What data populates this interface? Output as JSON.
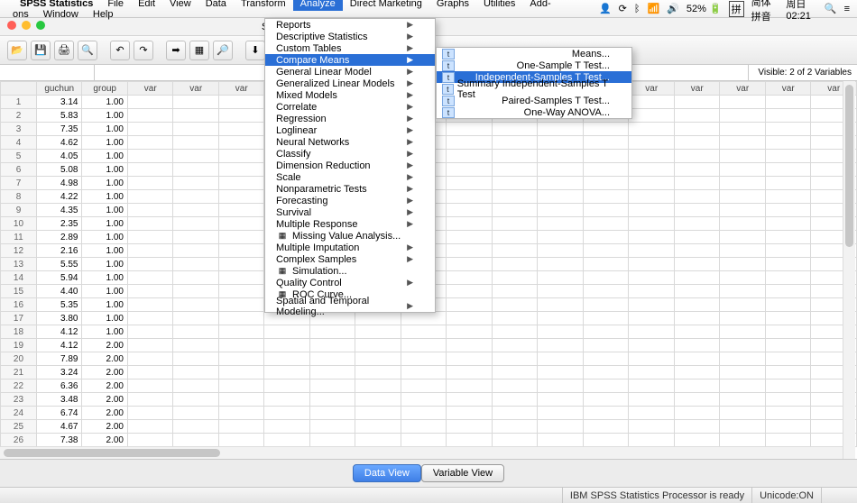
{
  "mac_menu": {
    "items": [
      "SPSS Statistics",
      "File",
      "Edit",
      "View",
      "Data",
      "Transform",
      "Analyze",
      "Direct Marketing",
      "Graphs",
      "Utilities",
      "Add-ons",
      "Window",
      "Help"
    ],
    "highlighted_index": 6,
    "right": {
      "battery": "52%",
      "ime_box": "拼",
      "ime_label": "简体拼音",
      "clock": "周日02:21"
    }
  },
  "window": {
    "title": "SPSS Statistics Data Editor"
  },
  "formula": {
    "visible_text": "Visible: 2 of 2 Variables"
  },
  "columns": {
    "named": [
      "guchun",
      "group"
    ],
    "var_placeholder": "var",
    "extra_count": 16
  },
  "rows": [
    {
      "n": 1,
      "guchun": "3.14",
      "group": "1.00"
    },
    {
      "n": 2,
      "guchun": "5.83",
      "group": "1.00"
    },
    {
      "n": 3,
      "guchun": "7.35",
      "group": "1.00"
    },
    {
      "n": 4,
      "guchun": "4.62",
      "group": "1.00"
    },
    {
      "n": 5,
      "guchun": "4.05",
      "group": "1.00"
    },
    {
      "n": 6,
      "guchun": "5.08",
      "group": "1.00"
    },
    {
      "n": 7,
      "guchun": "4.98",
      "group": "1.00"
    },
    {
      "n": 8,
      "guchun": "4.22",
      "group": "1.00"
    },
    {
      "n": 9,
      "guchun": "4.35",
      "group": "1.00"
    },
    {
      "n": 10,
      "guchun": "2.35",
      "group": "1.00"
    },
    {
      "n": 11,
      "guchun": "2.89",
      "group": "1.00"
    },
    {
      "n": 12,
      "guchun": "2.16",
      "group": "1.00"
    },
    {
      "n": 13,
      "guchun": "5.55",
      "group": "1.00"
    },
    {
      "n": 14,
      "guchun": "5.94",
      "group": "1.00"
    },
    {
      "n": 15,
      "guchun": "4.40",
      "group": "1.00"
    },
    {
      "n": 16,
      "guchun": "5.35",
      "group": "1.00"
    },
    {
      "n": 17,
      "guchun": "3.80",
      "group": "1.00"
    },
    {
      "n": 18,
      "guchun": "4.12",
      "group": "1.00"
    },
    {
      "n": 19,
      "guchun": "4.12",
      "group": "2.00"
    },
    {
      "n": 20,
      "guchun": "7.89",
      "group": "2.00"
    },
    {
      "n": 21,
      "guchun": "3.24",
      "group": "2.00"
    },
    {
      "n": 22,
      "guchun": "6.36",
      "group": "2.00"
    },
    {
      "n": 23,
      "guchun": "3.48",
      "group": "2.00"
    },
    {
      "n": 24,
      "guchun": "6.74",
      "group": "2.00"
    },
    {
      "n": 25,
      "guchun": "4.67",
      "group": "2.00"
    },
    {
      "n": 26,
      "guchun": "7.38",
      "group": "2.00"
    }
  ],
  "analyze_menu": {
    "items": [
      {
        "label": "Reports",
        "sub": true
      },
      {
        "label": "Descriptive Statistics",
        "sub": true
      },
      {
        "label": "Custom Tables",
        "sub": true
      },
      {
        "label": "Compare Means",
        "sub": true,
        "hl": true
      },
      {
        "label": "General Linear Model",
        "sub": true
      },
      {
        "label": "Generalized Linear Models",
        "sub": true
      },
      {
        "label": "Mixed Models",
        "sub": true
      },
      {
        "label": "Correlate",
        "sub": true
      },
      {
        "label": "Regression",
        "sub": true
      },
      {
        "label": "Loglinear",
        "sub": true
      },
      {
        "label": "Neural Networks",
        "sub": true
      },
      {
        "label": "Classify",
        "sub": true
      },
      {
        "label": "Dimension Reduction",
        "sub": true
      },
      {
        "label": "Scale",
        "sub": true
      },
      {
        "label": "Nonparametric Tests",
        "sub": true
      },
      {
        "label": "Forecasting",
        "sub": true
      },
      {
        "label": "Survival",
        "sub": true
      },
      {
        "label": "Multiple Response",
        "sub": true
      },
      {
        "label": "Missing Value Analysis...",
        "sub": false,
        "icon": "mva"
      },
      {
        "label": "Multiple Imputation",
        "sub": true
      },
      {
        "label": "Complex Samples",
        "sub": true
      },
      {
        "label": "Simulation...",
        "sub": false,
        "icon": "sim"
      },
      {
        "label": "Quality Control",
        "sub": true
      },
      {
        "label": "ROC Curve...",
        "sub": false,
        "icon": "roc"
      },
      {
        "label": "Spatial and Temporal Modeling...",
        "sub": true
      }
    ]
  },
  "compare_means_submenu": {
    "items": [
      {
        "label": "Means...",
        "icon": "M"
      },
      {
        "label": "One-Sample T Test...",
        "icon": "t"
      },
      {
        "label": "Independent-Samples T Test...",
        "icon": "it",
        "hl": true
      },
      {
        "label": "Summary Independent-Samples T Test",
        "icon": "sit"
      },
      {
        "label": "Paired-Samples T Test...",
        "icon": "pt"
      },
      {
        "label": "One-Way ANOVA...",
        "icon": "a"
      }
    ]
  },
  "tabs": {
    "data": "Data View",
    "variable": "Variable View",
    "active": "data"
  },
  "status": {
    "processor": "IBM SPSS Statistics Processor is ready",
    "unicode": "Unicode:ON"
  },
  "toolbar_icons": [
    "open",
    "save",
    "print",
    "examine",
    "undo",
    "redo",
    "goto",
    "vars",
    "find",
    "insert-case",
    "insert-var",
    "split",
    "weight",
    "select",
    "value-labels",
    "spell"
  ]
}
